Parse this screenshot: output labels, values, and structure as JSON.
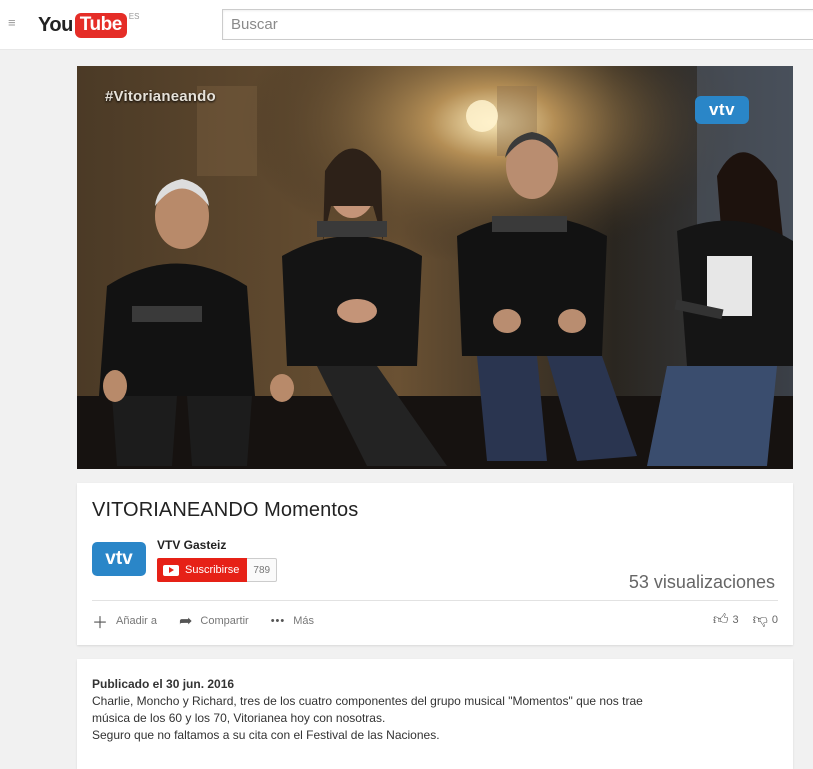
{
  "header": {
    "logo_you": "You",
    "logo_tube": "Tube",
    "logo_region": "ES",
    "search_placeholder": "Buscar"
  },
  "video": {
    "overlay_hashtag": "#Vitorianeando",
    "overlay_logo": "vtv"
  },
  "info": {
    "title": "VITORIANEANDO Momentos",
    "channel_avatar_text": "vtv",
    "channel_name": "VTV Gasteiz",
    "subscribe_label": "Suscribirse",
    "subscriber_count": "789",
    "views": "53 visualizaciones",
    "actions": [
      {
        "icon": "plus-icon",
        "label": "Añadir a"
      },
      {
        "icon": "share-icon",
        "label": "Compartir"
      },
      {
        "icon": "more-icon",
        "label": "Más"
      }
    ],
    "likes": "3",
    "dislikes": "0"
  },
  "description": {
    "published": "Publicado el 30 jun. 2016",
    "lines": [
      "Charlie, Moncho y Richard, tres de los cuatro componentes del grupo musical \"Momentos\" que nos trae",
      "música de los 60 y los 70, Vitorianea hoy con nosotras.",
      "Seguro que no faltamos a su cita con el Festival de las Naciones."
    ]
  },
  "colors": {
    "brand_red": "#e52d27",
    "vtv_blue": "#2a86c8",
    "background": "#f1f1f1"
  }
}
